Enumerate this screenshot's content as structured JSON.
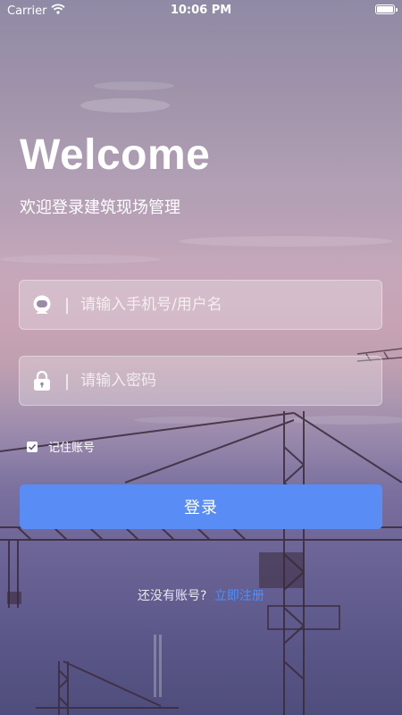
{
  "status_bar": {
    "carrier": "Carrier",
    "time": "10:06 PM"
  },
  "header": {
    "title": "Welcome",
    "subtitle": "欢迎登录建筑现场管理"
  },
  "form": {
    "username_placeholder": "请输入手机号/用户名",
    "username_value": "",
    "password_placeholder": "请输入密码",
    "password_value": "",
    "separator": "|",
    "remember_label": "记住账号",
    "remember_checked": true,
    "login_label": "登录"
  },
  "footer": {
    "no_account_text": "还没有账号?",
    "register_link": "立即注册"
  },
  "colors": {
    "accent": "#5a8cf5",
    "link": "#4a90ff"
  },
  "icons": {
    "user": "user-avatar-icon",
    "lock": "lock-icon",
    "check": "check-icon",
    "wifi": "wifi-icon",
    "battery": "battery-icon"
  }
}
